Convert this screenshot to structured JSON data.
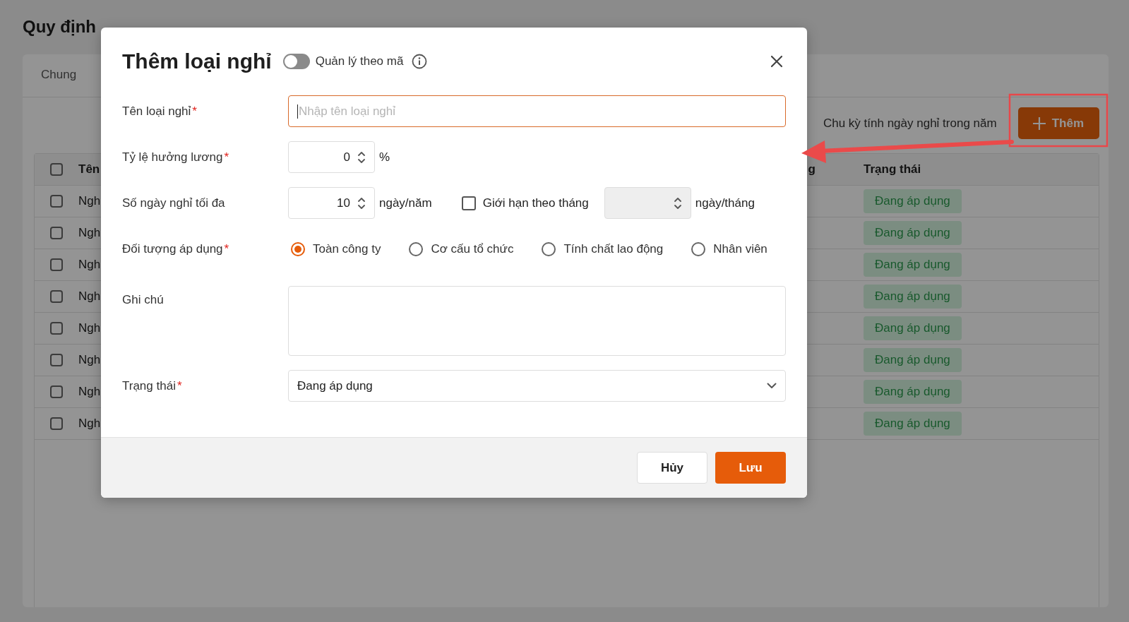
{
  "page": {
    "title": "Quy định",
    "tabs": [
      {
        "label": "Chung",
        "selected": false
      }
    ],
    "cycle_label": "Chu kỳ tính ngày nghỉ trong năm",
    "add_button": "Thêm"
  },
  "table": {
    "header_checked": false,
    "columns": [
      "Tên",
      "g",
      "Trạng thái"
    ],
    "rows": [
      {
        "checked": false,
        "name": "Ngh",
        "status": "Đang áp dụng"
      },
      {
        "checked": false,
        "name": "Ngh",
        "status": "Đang áp dụng"
      },
      {
        "checked": false,
        "name": "Ngh",
        "status": "Đang áp dụng"
      },
      {
        "checked": false,
        "name": "Ngh",
        "status": "Đang áp dụng"
      },
      {
        "checked": false,
        "name": "Ngh",
        "status": "Đang áp dụng"
      },
      {
        "checked": false,
        "name": "Ngh",
        "status": "Đang áp dụng"
      },
      {
        "checked": false,
        "name": "Ngh",
        "status": "Đang áp dụng"
      },
      {
        "checked": false,
        "name": "Ngh",
        "status": "Đang áp dụng"
      }
    ]
  },
  "dialog": {
    "title": "Thêm loại nghỉ",
    "manage_by_code": {
      "label": "Quản lý theo mã",
      "on": false
    },
    "name_field": {
      "label": "Tên loại nghỉ",
      "mark": "*",
      "placeholder": "Nhập tên loại nghỉ",
      "focused": true
    },
    "pay_rate": {
      "label": "Tỷ lệ hưởng lương",
      "mark": "*",
      "value": "0",
      "unit": "%"
    },
    "max_days": {
      "label": "Số ngày nghỉ tối đa",
      "value": "10",
      "unit": "ngày/năm",
      "monthly_limit": {
        "label": "Giới hạn theo tháng",
        "checked": false
      },
      "monthly_field_disabled": true,
      "monthly_unit": "ngày/tháng"
    },
    "applies_to": {
      "label": "Đối tượng áp dụng",
      "mark": "*",
      "options": [
        {
          "label": "Toàn công ty",
          "selected": true
        },
        {
          "label": "Cơ cấu tổ chức",
          "selected": false
        },
        {
          "label": "Tính chất lao động",
          "selected": false
        },
        {
          "label": "Nhân viên",
          "selected": false
        }
      ]
    },
    "note": {
      "label": "Ghi chú"
    },
    "status": {
      "label": "Trạng thái",
      "mark": "*",
      "value": "Đang áp dụng"
    },
    "buttons": [
      {
        "label": "Hủy",
        "kind": "secondary"
      },
      {
        "label": "Lưu",
        "kind": "primary"
      }
    ]
  }
}
